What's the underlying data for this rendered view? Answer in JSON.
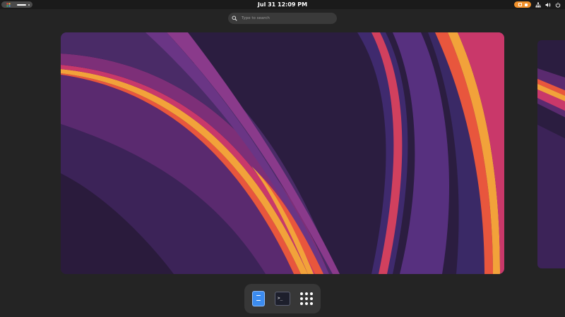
{
  "top_bar": {
    "clock": "Jul 31  12:09 PM",
    "activities_icon": "activities-indicator-icon",
    "status_icons": [
      "network-icon",
      "volume-icon",
      "power-icon"
    ],
    "indicator_icons": [
      "screen-record-icon",
      "stop-icon"
    ],
    "accent_color": "#f0902b"
  },
  "search": {
    "placeholder": "Type to search",
    "value": "",
    "icon": "search-icon"
  },
  "dash": {
    "items": [
      {
        "name": "files-app",
        "icon": "files-icon"
      },
      {
        "name": "terminal-app",
        "icon": "terminal-icon",
        "glyph": ">_"
      },
      {
        "name": "show-apps",
        "icon": "app-grid-icon"
      }
    ]
  },
  "workspaces": {
    "count_visible": 2,
    "wallpaper": "abstract-purple-orange-waves"
  }
}
